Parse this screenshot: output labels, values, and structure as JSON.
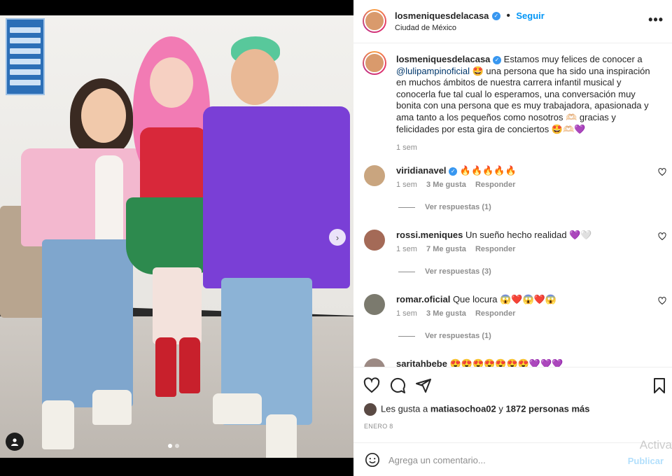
{
  "post": {
    "username": "losmeniquesdelacasa",
    "follow_label": "Seguir",
    "location": "Ciudad de México",
    "more_label": "•••"
  },
  "caption": {
    "username": "losmeniquesdelacasa",
    "text_1": " Estamos muy felices de conocer a ",
    "mention": "@lulipampinoficial",
    "text_2": " 🤩 una persona que ha sido una inspiración en muchos ámbitos de nuestra carrera infantil musical y conocerla fue tal cual lo esperamos, una conversación muy bonita con una persona que es muy trabajadora, apasionada y ama tanto a los pequeños como nosotros 🫶🏻 gracias y felicidades por esta gira de conciertos 🤩🫶🏻💜",
    "time": "1 sem"
  },
  "comments": [
    {
      "username": "viridianavel",
      "verified": true,
      "text": "🔥🔥🔥🔥🔥",
      "time": "1 sem",
      "likes": "3 Me gusta",
      "reply": "Responder",
      "replies": "Ver respuestas (1)",
      "avatar_color": "#c9a57f"
    },
    {
      "username": "rossi.meniques",
      "verified": false,
      "text": "Un sueño hecho realidad 💜🤍",
      "time": "1 sem",
      "likes": "7 Me gusta",
      "reply": "Responder",
      "replies": "Ver respuestas (3)",
      "avatar_color": "#a46a57"
    },
    {
      "username": "romar.oficial",
      "verified": false,
      "text": "Que locura 😱❤️😱❤️😱",
      "time": "1 sem",
      "likes": "3 Me gusta",
      "reply": "Responder",
      "replies": "Ver respuestas (1)",
      "avatar_color": "#7b7a6e"
    },
    {
      "username": "saritahbebe",
      "verified": false,
      "text": "😍😍😍😍😍😍😍💜💜💜",
      "avatar_color": "#9c8a84"
    }
  ],
  "likes": {
    "prefix": "Les gusta a ",
    "user": "matiasochoa02",
    "middle": " y ",
    "count": "1872 personas más"
  },
  "date": "ENERO 8",
  "add_comment": {
    "placeholder": "Agrega un comentario...",
    "publish": "Publicar"
  },
  "watermark": "Activa",
  "icons": [
    "heart-icon",
    "comment-icon",
    "share-icon",
    "bookmark-icon",
    "emoji-icon",
    "chevron-right-icon",
    "user-tag-icon",
    "more-icon"
  ],
  "colors": {
    "accent": "#0095f6",
    "verified": "#3897f0",
    "text": "#262626",
    "muted": "#8e8e8e"
  }
}
